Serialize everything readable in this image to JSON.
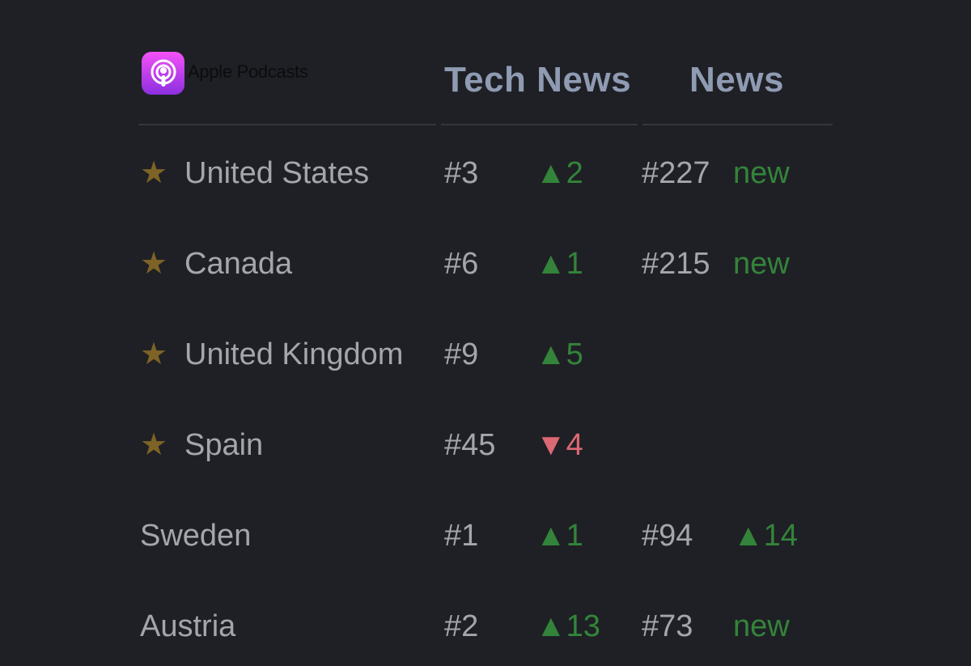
{
  "header": {
    "brand": "Apple Podcasts",
    "brand_icon": "podcasts-icon",
    "columns": [
      "Tech News",
      "News"
    ]
  },
  "colors": {
    "background": "#1f2025",
    "header_text": "#8f9bb3",
    "row_text": "#a4a6ad",
    "star": "#7d6325",
    "up": "#33843a",
    "down": "#dc6874"
  },
  "rows": [
    {
      "country": "United States",
      "starred": true,
      "tech_rank": "#3",
      "tech_change": "▲2",
      "tech_dir": "up",
      "news_rank": "#227",
      "news_change": "new",
      "news_dir": "new"
    },
    {
      "country": "Canada",
      "starred": true,
      "tech_rank": "#6",
      "tech_change": "▲1",
      "tech_dir": "up",
      "news_rank": "#215",
      "news_change": "new",
      "news_dir": "new"
    },
    {
      "country": "United Kingdom",
      "starred": true,
      "tech_rank": "#9",
      "tech_change": "▲5",
      "tech_dir": "up",
      "news_rank": "",
      "news_change": "",
      "news_dir": ""
    },
    {
      "country": "Spain",
      "starred": true,
      "tech_rank": "#45",
      "tech_change": "▼4",
      "tech_dir": "down",
      "news_rank": "",
      "news_change": "",
      "news_dir": ""
    },
    {
      "country": "Sweden",
      "starred": false,
      "tech_rank": "#1",
      "tech_change": "▲1",
      "tech_dir": "up",
      "news_rank": "#94",
      "news_change": "▲14",
      "news_dir": "up"
    },
    {
      "country": "Austria",
      "starred": false,
      "tech_rank": "#2",
      "tech_change": "▲13",
      "tech_dir": "up",
      "news_rank": "#73",
      "news_change": "new",
      "news_dir": "new"
    }
  ]
}
